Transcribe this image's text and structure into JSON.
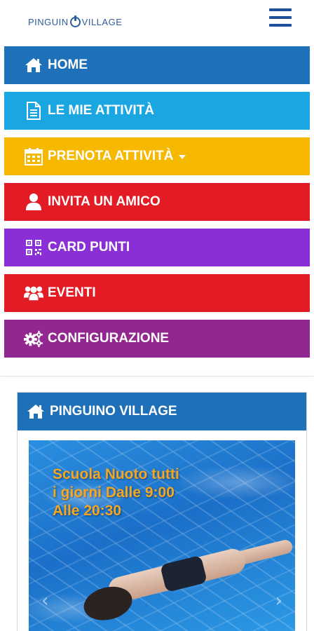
{
  "header": {
    "logo_left": "PINGUIN",
    "logo_right": "VILLAGE"
  },
  "menu": {
    "items": [
      {
        "label": "HOME",
        "color": "#1e70b8",
        "icon": "home-icon"
      },
      {
        "label": "LE MIE ATTIVITÀ",
        "color": "#1aa6e0",
        "icon": "document-icon"
      },
      {
        "label": "PRENOTA ATTIVITÀ",
        "color": "#f7b800",
        "icon": "calendar-icon"
      },
      {
        "label": "INVITA UN AMICO",
        "color": "#e31b24",
        "icon": "user-icon"
      },
      {
        "label": "CARD PUNTI",
        "color": "#8a2fd6",
        "icon": "qr-code-icon"
      },
      {
        "label": "EVENTI",
        "color": "#e31b24",
        "icon": "group-icon"
      },
      {
        "label": "CONFIGURAZIONE",
        "color": "#92278f",
        "icon": "gears-icon"
      }
    ]
  },
  "panel": {
    "title": "PINGUINO VILLAGE",
    "icon": "home-icon",
    "slide": {
      "caption_line1": "Scuola Nuoto tutti",
      "caption_line2": "i giorni Dalle 9:00",
      "caption_line3": "Alle 20:30",
      "prev": "‹",
      "next": "›"
    }
  }
}
